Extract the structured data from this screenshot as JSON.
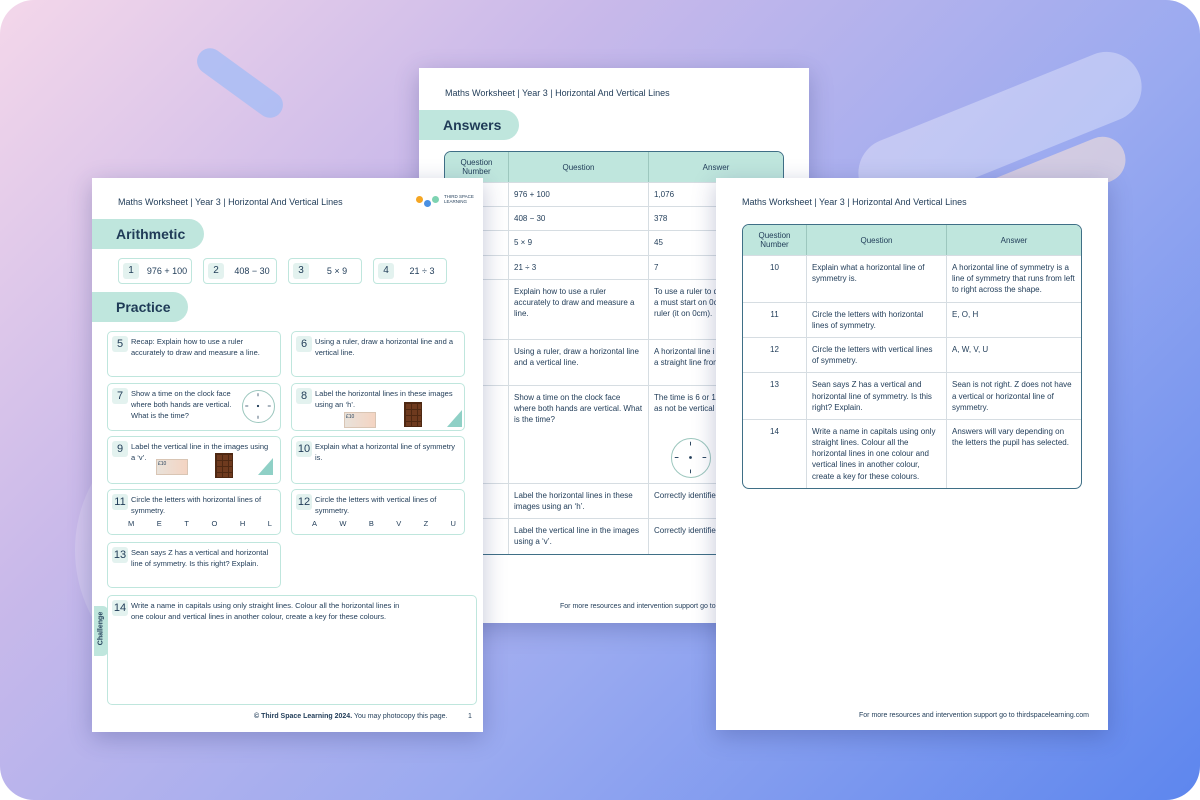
{
  "header_text": "Maths Worksheet | Year 3 | Horizontal And Vertical Lines",
  "logo": {
    "line1": "THIRD SPACE",
    "line2": "LEARNING",
    "colors": [
      "#f5a623",
      "#4a90e2",
      "#7ed3b2"
    ]
  },
  "answers_page": {
    "section_title": "Answers",
    "columns": [
      "Question Number",
      "Question",
      "Answer"
    ],
    "rows": [
      {
        "q": "976 + 100",
        "a": "1,076"
      },
      {
        "q": "408 − 30",
        "a": "378"
      },
      {
        "q": "5 × 9",
        "a": "45"
      },
      {
        "q": "21 ÷ 3",
        "a": "7"
      },
      {
        "q": "Explain how to use a ruler accurately to draw and measure a line.",
        "a": "To use a ruler to d line or measure a must start on 0cm end of the ruler (it on 0cm)."
      },
      {
        "q": "Using a ruler, draw a horizontal line and a vertical line.",
        "a": "A horizontal line i from left to right. a straight line from"
      },
      {
        "q": "Show a time on the clock face where both hands are vertical. What is the time?",
        "a": "The time is 6 or 1 cannot be 6:30 as not be vertical for accurate."
      },
      {
        "q": "Label the horizontal lines in these images using an ‘h’.",
        "a": "Correctly identifie lines."
      },
      {
        "q": "Label the vertical line in the images using a ‘v’.",
        "a": "Correctly identifie"
      }
    ],
    "footer": "For more resources and intervention support go to"
  },
  "answers_page_2": {
    "columns": [
      "Question Number",
      "Question",
      "Answer"
    ],
    "rows": [
      {
        "n": "10",
        "q": "Explain what a horizontal line of symmetry is.",
        "a": "A horizontal line of symmetry is a line of symmetry that runs from left to right across the shape."
      },
      {
        "n": "11",
        "q": "Circle the letters with horizontal lines of symmetry.",
        "a": "E, O, H"
      },
      {
        "n": "12",
        "q": "Circle the letters with vertical lines of symmetry.",
        "a": "A, W, V, U"
      },
      {
        "n": "13",
        "q": "Sean says Z has a vertical and horizontal line of symmetry. Is this right? Explain.",
        "a": "Sean is not right. Z does not have a vertical or horizontal line of symmetry."
      },
      {
        "n": "14",
        "q": "Write a name in capitals using only straight lines. Colour all the horizontal lines in one colour and vertical lines in another colour, create a key for these colours.",
        "a": "Answers will vary depending on the letters the pupil has selected."
      }
    ],
    "footer": "For more resources and intervention support go to thirdspacelearning.com"
  },
  "worksheet": {
    "arithmetic_title": "Arithmetic",
    "arithmetic": [
      {
        "n": "1",
        "e": "976 + 100"
      },
      {
        "n": "2",
        "e": "408 − 30"
      },
      {
        "n": "3",
        "e": "5 × 9"
      },
      {
        "n": "4",
        "e": "21 ÷ 3"
      }
    ],
    "practice_title": "Practice",
    "practice": [
      {
        "n": "5",
        "t": "Recap: Explain how to use a ruler accurately to draw and measure a line."
      },
      {
        "n": "6",
        "t": "Using a ruler, draw a horizontal line and a vertical line."
      },
      {
        "n": "7",
        "t": "Show a time on the clock face where both hands are vertical. What is the time?"
      },
      {
        "n": "8",
        "t": "Label the horizontal lines in these images using an ‘h’."
      },
      {
        "n": "9",
        "t": "Label the vertical line in the images using a ‘v’."
      },
      {
        "n": "10",
        "t": "Explain what a horizontal line of symmetry is."
      },
      {
        "n": "11",
        "t": "Circle the letters with horizontal lines of symmetry.",
        "letters": [
          "M",
          "E",
          "T",
          "O",
          "H",
          "L"
        ]
      },
      {
        "n": "12",
        "t": "Circle the letters with vertical lines of symmetry.",
        "letters": [
          "A",
          "W",
          "B",
          "V",
          "Z",
          "U"
        ]
      },
      {
        "n": "13",
        "t": "Sean says Z has a vertical and horizontal line of symmetry. Is this right? Explain."
      }
    ],
    "challenge_label": "Challenge",
    "challenge": {
      "n": "14",
      "t": "Write a name in capitals using only straight lines. Colour all the horizontal lines in one colour and vertical lines in another colour, create a key for these colours."
    },
    "note_label": "£10",
    "footer_bold": "© Third Space Learning 2024.",
    "footer_rest": " You may photocopy this page.",
    "page_number": "1"
  }
}
